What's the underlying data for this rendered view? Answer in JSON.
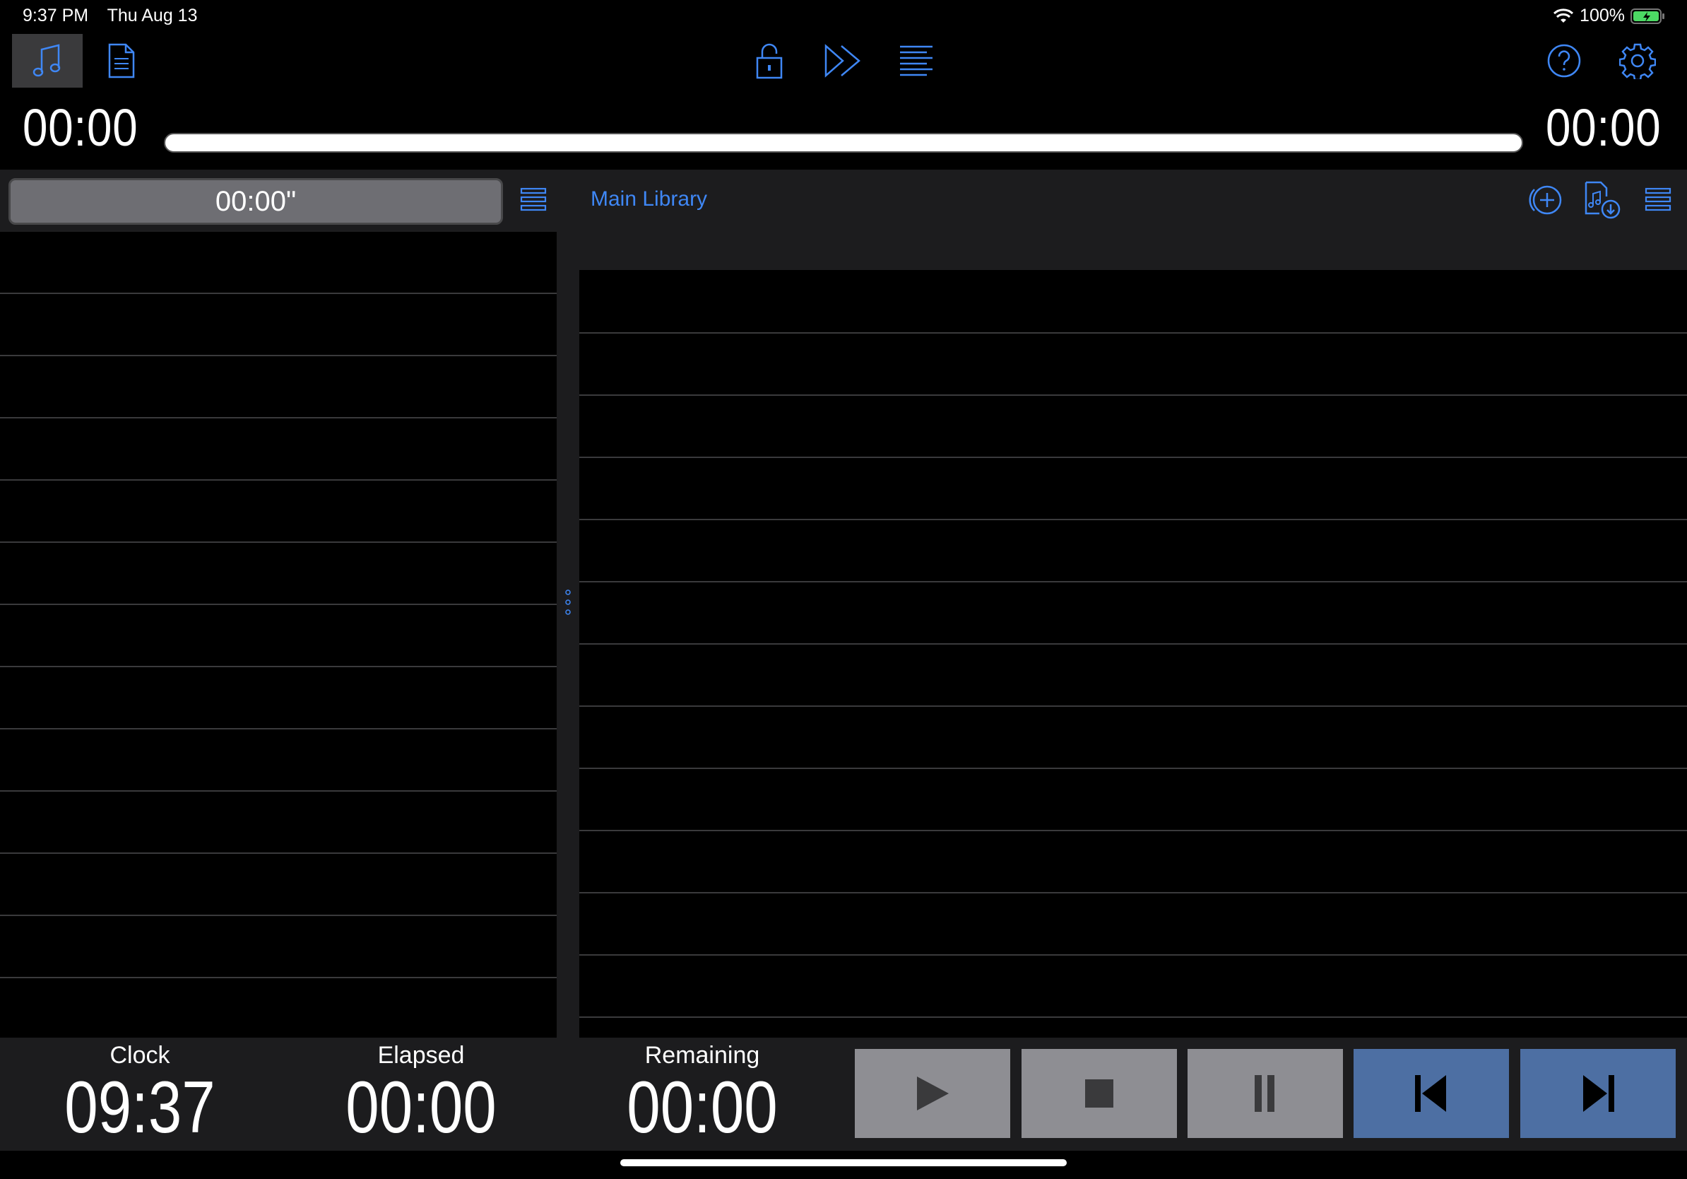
{
  "status_bar": {
    "time": "9:37 PM",
    "date": "Thu Aug 13",
    "battery": "100%"
  },
  "toolbar": {
    "left_icons": [
      "music-note-icon",
      "document-icon"
    ],
    "center_icons": [
      "lock-icon",
      "fast-forward-icon",
      "text-align-icon"
    ],
    "right_icons": [
      "help-icon",
      "gear-icon"
    ]
  },
  "transport": {
    "elapsed_top": "00:00",
    "remaining_top": "00:00",
    "progress": 0
  },
  "left_panel": {
    "timer": "00:00\""
  },
  "library": {
    "title": "Main Library"
  },
  "bottom": {
    "clock_label": "Clock",
    "clock_value": "09:37",
    "elapsed_label": "Elapsed",
    "elapsed_value": "00:00",
    "remaining_label": "Remaining",
    "remaining_value": "00:00"
  },
  "colors": {
    "accent": "#3f87f5",
    "button_gray": "#8e8e93",
    "button_blue": "#4d6fa3"
  }
}
